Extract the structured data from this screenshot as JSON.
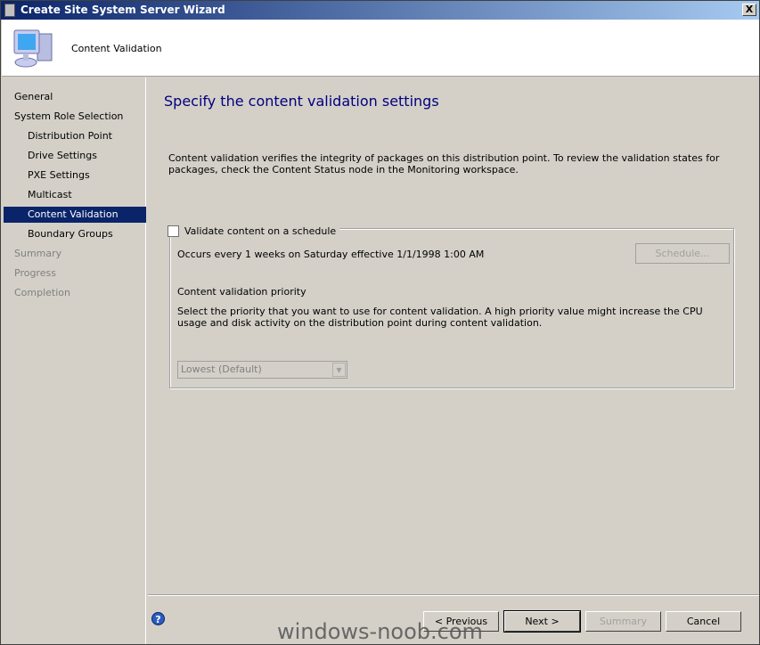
{
  "window": {
    "title": "Create Site System Server Wizard",
    "close_label": "X"
  },
  "header": {
    "title": "Content Validation",
    "icon": "computer-icon"
  },
  "sidebar": {
    "items": [
      {
        "label": "General",
        "level": 0,
        "state": "normal"
      },
      {
        "label": "System Role Selection",
        "level": 0,
        "state": "normal"
      },
      {
        "label": "Distribution Point",
        "level": 1,
        "state": "normal"
      },
      {
        "label": "Drive Settings",
        "level": 1,
        "state": "normal"
      },
      {
        "label": "PXE Settings",
        "level": 1,
        "state": "normal"
      },
      {
        "label": "Multicast",
        "level": 1,
        "state": "normal"
      },
      {
        "label": "Content Validation",
        "level": 1,
        "state": "active"
      },
      {
        "label": "Boundary Groups",
        "level": 1,
        "state": "normal"
      },
      {
        "label": "Summary",
        "level": 0,
        "state": "disabled"
      },
      {
        "label": "Progress",
        "level": 0,
        "state": "disabled"
      },
      {
        "label": "Completion",
        "level": 0,
        "state": "disabled"
      }
    ]
  },
  "main": {
    "title": "Specify the content validation settings",
    "description": "Content validation verifies the integrity of packages on this distribution point. To review the validation states for packages, check the Content Status node in the Monitoring workspace.",
    "schedule_checkbox": {
      "label": "Validate content on a schedule",
      "checked": false
    },
    "occurs_text": "Occurs every 1 weeks on Saturday effective 1/1/1998 1:00 AM",
    "schedule_button": "Schedule...",
    "priority_label": "Content validation priority",
    "priority_description": "Select the priority that you want to use for content validation. A high priority value might increase the CPU usage and disk activity on the distribution point during content validation.",
    "priority_value": "Lowest (Default)"
  },
  "footer": {
    "previous": "< Previous",
    "next": "Next >",
    "summary": "Summary",
    "cancel": "Cancel",
    "help": "?"
  },
  "watermark": "windows-noob.com"
}
